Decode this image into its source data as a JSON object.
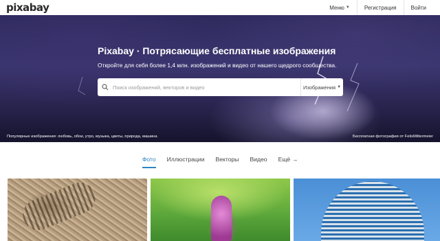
{
  "header": {
    "logo": "pixabay",
    "nav": [
      {
        "label": "Меню",
        "has_caret": true
      },
      {
        "label": "Регистрация"
      },
      {
        "label": "Войти"
      }
    ]
  },
  "hero": {
    "title": "Pixabay · Потрясающие бесплатные изображения",
    "subtitle": "Откройте для себя более 1,4 млн. изображений и видео от нашего щедрого сообщества.",
    "search": {
      "placeholder": "Поиск изображений, векторов и видео",
      "type_label": "Изображения"
    },
    "popular": "Популярные изображения: любовь, обои, утро, музыка, цветы, природа, машина",
    "credit": "Бесплатная фотография от FelixMittermeier"
  },
  "tabs": [
    {
      "label": "Фото",
      "active": true
    },
    {
      "label": "Иллюстрации"
    },
    {
      "label": "Векторы"
    },
    {
      "label": "Видео"
    },
    {
      "label": "Ещё →"
    }
  ],
  "colors": {
    "accent": "#2b83c5"
  }
}
